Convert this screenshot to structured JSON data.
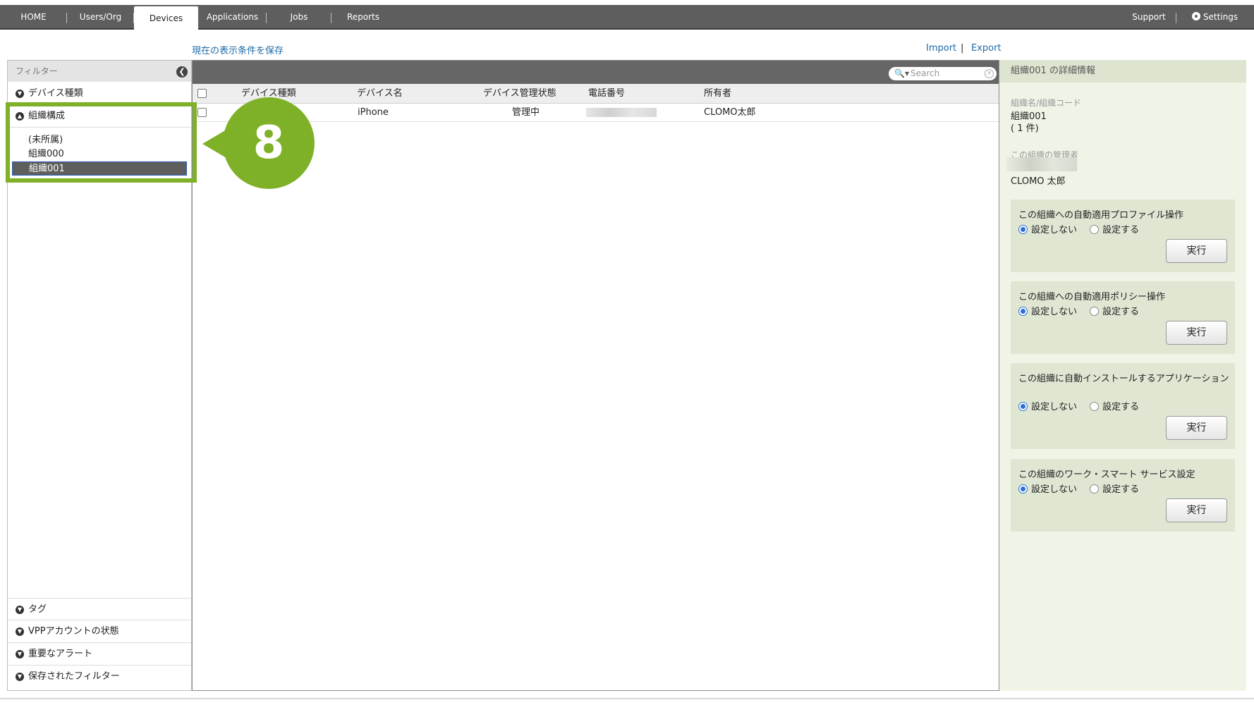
{
  "nav": {
    "tabs": [
      "HOME",
      "Users/Org",
      "Devices",
      "Applications",
      "Jobs",
      "Reports"
    ],
    "active_tab": "Devices",
    "support": "Support",
    "settings": "Settings"
  },
  "links": {
    "save_view": "現在の表示条件を保存",
    "import": "Import",
    "separator": "|",
    "export": "Export"
  },
  "sidebar": {
    "title": "フィルター",
    "device_type": "デバイス種類",
    "org_structure": "組織構成",
    "orgs": [
      "(未所属)",
      "組織000",
      "組織001"
    ],
    "selected_org": "組織001",
    "tag": "タグ",
    "vpp": "VPPアカウントの状態",
    "alerts": "重要なアラート",
    "saved_filters": "保存されたフィルター"
  },
  "callout": {
    "number": "8",
    "color": "#7fb128"
  },
  "table": {
    "search_placeholder": "Search",
    "columns": [
      "デバイス種類",
      "デバイス名",
      "デバイス管理状態",
      "電話番号",
      "所有者"
    ],
    "rows": [
      {
        "device_type": "",
        "device_name": "iPhone",
        "status": "管理中",
        "phone": "",
        "owner": "CLOMO太郎"
      }
    ]
  },
  "detail": {
    "title": "組織001 の詳細情報",
    "name_label": "組織名/組織コード",
    "name_value": "組織001",
    "count": "( 1 件)",
    "admin_label": "この組織の管理者",
    "admin_value": "CLOMO 太郎",
    "cards": [
      {
        "title": "この組織への自動適用プロファイル操作",
        "off": "設定しない",
        "on": "設定する",
        "button": "実行"
      },
      {
        "title": "この組織への自動適用ポリシー操作",
        "off": "設定しない",
        "on": "設定する",
        "button": "実行"
      },
      {
        "title": "この組織に自動インストールするアプリケーション",
        "off": "設定しない",
        "on": "設定する",
        "button": "実行"
      },
      {
        "title": "この組織のワーク・スマート サービス設定",
        "off": "設定しない",
        "on": "設定する",
        "button": "実行"
      }
    ]
  }
}
